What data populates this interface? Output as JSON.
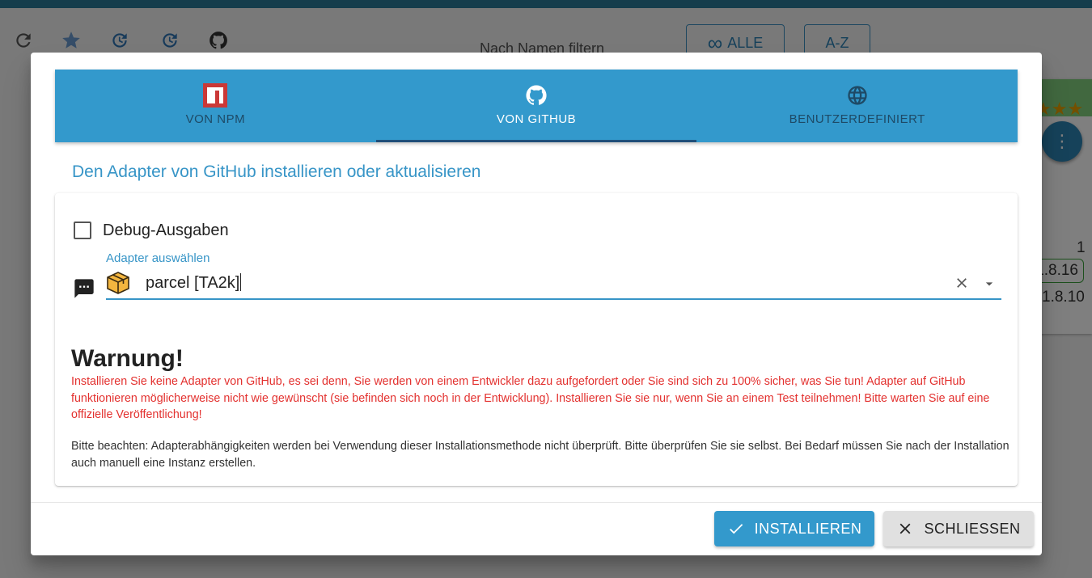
{
  "background": {
    "filter_placeholder": "Nach Namen filtern",
    "filter_all_label": "ALLE",
    "sort_label": "A-Z",
    "card_number": "1",
    "card_version_installed": "1.8.16",
    "card_version_available": "1.8.10",
    "card_stars": "★★★"
  },
  "dialog": {
    "tabs": [
      {
        "label": "VON NPM",
        "icon": "npm-icon"
      },
      {
        "label": "VON GITHUB",
        "icon": "github-icon"
      },
      {
        "label": "BENUTZERDEFINIERT",
        "icon": "globe-icon"
      }
    ],
    "active_tab": 1,
    "heading": "Den Adapter von GitHub installieren oder aktualisieren",
    "debug_label": "Debug-Ausgaben",
    "debug_checked": false,
    "adapter_select": {
      "label": "Adapter auswählen",
      "value": "parcel [TA2k]",
      "icon": "package-icon"
    },
    "warning_title": "Warnung!",
    "warning_text": "Installieren Sie keine Adapter von GitHub, es sei denn, Sie werden von einem Entwickler dazu aufgefordert oder Sie sind sich zu 100% sicher, was Sie tun! Adapter auf GitHub funktionieren möglicherweise nicht wie gewünscht (sie befinden sich noch in der Entwicklung). Installieren Sie sie nur, wenn Sie an einem Test teilnehmen! Bitte warten Sie auf eine offizielle Veröffentlichung!",
    "note_text": "Bitte beachten: Adapterabhängigkeiten werden bei Verwendung dieser Installationsmethode nicht überprüft. Bitte überprüfen Sie sie selbst. Bei Bedarf müssen Sie nach der Installation auch manuell eine Instanz erstellen.",
    "install_button": "INSTALLIEREN",
    "close_button": "SCHLIESSEN"
  },
  "colors": {
    "accent": "#3399cc",
    "warning": "#e3312f",
    "topbar": "#2b7a99"
  }
}
